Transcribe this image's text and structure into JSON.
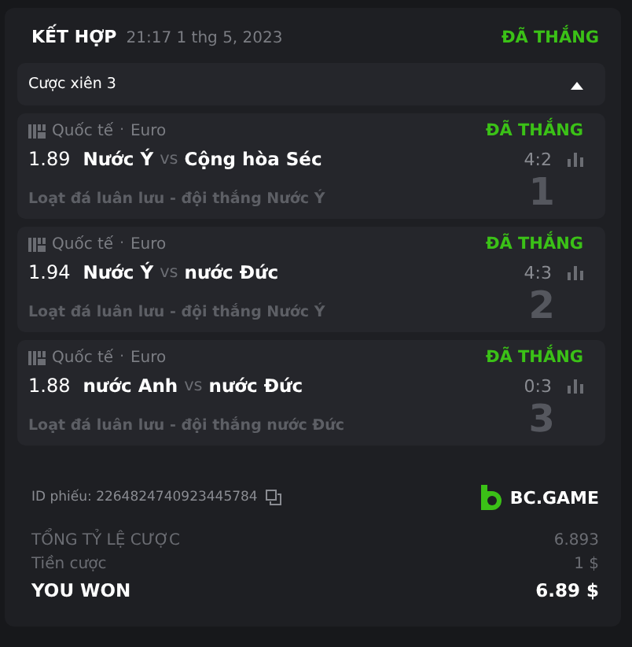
{
  "header": {
    "type": "KẾT HỢP",
    "datetime": "21:17 1 thg 5, 2023",
    "status": "ĐÃ THẮNG"
  },
  "parlay": {
    "label": "Cược xiên 3",
    "expanded": true
  },
  "legs": [
    {
      "league": "Quốc tế",
      "separator": "·",
      "tournament": "Euro",
      "status": "ĐÃ THẮNG",
      "odds": "1.89",
      "home": "Nước Ý",
      "vs": "vs",
      "away": "Cộng hòa Séc",
      "score": "4:2",
      "market": "Loạt đá luân lưu - đội thắng Nước Ý",
      "index": "1"
    },
    {
      "league": "Quốc tế",
      "separator": "·",
      "tournament": "Euro",
      "status": "ĐÃ THẮNG",
      "odds": "1.94",
      "home": "Nước Ý",
      "vs": "vs",
      "away": "nước Đức",
      "score": "4:3",
      "market": "Loạt đá luân lưu - đội thắng Nước Ý",
      "index": "2"
    },
    {
      "league": "Quốc tế",
      "separator": "·",
      "tournament": "Euro",
      "status": "ĐÃ THẮNG",
      "odds": "1.88",
      "home": "nước Anh",
      "vs": "vs",
      "away": "nước Đức",
      "score": "0:3",
      "market": "Loạt đá luân lưu - đội thắng nước Đức",
      "index": "3"
    }
  ],
  "ticket_id": "ID phiếu: 2264824740923445784",
  "brand": "BC.GAME",
  "summary": [
    {
      "label": "TỔNG TỶ LỆ CƯỢC",
      "value": "6.893",
      "kind": "muted"
    },
    {
      "label": "Tiền cược",
      "value": "1 $",
      "kind": "muted"
    },
    {
      "label": "YOU WON",
      "value": "6.89 $",
      "kind": "strong"
    }
  ]
}
